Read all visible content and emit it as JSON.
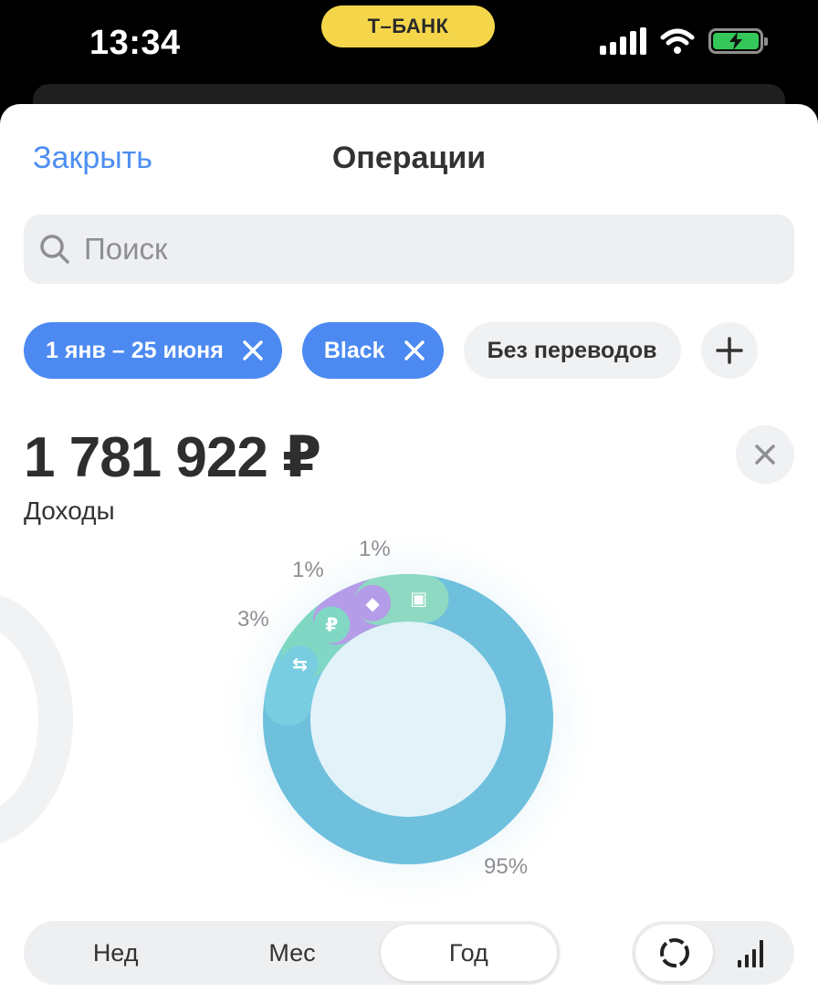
{
  "status_bar": {
    "time": "13:34",
    "bank_badge": "Т–БАНК",
    "icons": [
      "signal-icon",
      "wifi-icon",
      "battery-charging-icon"
    ]
  },
  "header": {
    "close_label": "Закрыть",
    "title": "Операции"
  },
  "search": {
    "placeholder": "Поиск"
  },
  "filters": {
    "chips": [
      {
        "label": "1 янв – 25 июня",
        "active": true,
        "removable": true
      },
      {
        "label": "Black",
        "active": true,
        "removable": true
      },
      {
        "label": "Без переводов",
        "active": false,
        "removable": false
      }
    ],
    "add_icon": "plus-icon"
  },
  "summary": {
    "amount": "1 781 922 ₽",
    "label": "Доходы"
  },
  "chart_data": {
    "type": "pie",
    "title": "",
    "slices": [
      {
        "label": "95%",
        "value": 95,
        "icon": "",
        "color": "#6ec0dd"
      },
      {
        "label": "3%",
        "value": 3,
        "icon": "transfer-icon",
        "color": "#79cde0"
      },
      {
        "label": "3%",
        "value": 3,
        "icon": "ruble-icon",
        "color": "#80d8c4"
      },
      {
        "label": "1%",
        "value": 1,
        "icon": "box-icon",
        "color": "#b59ce8"
      },
      {
        "label": "1%",
        "value": 1,
        "icon": "gift-icon",
        "color": "#8ed9c2"
      }
    ],
    "visible_labels": [
      "95%",
      "3%",
      "1%",
      "1%"
    ]
  },
  "period_selector": {
    "options": [
      "Нед",
      "Мес",
      "Год"
    ],
    "selected": "Год"
  },
  "view_toggle": {
    "options": [
      "donut-view-icon",
      "bar-view-icon"
    ],
    "selected": "donut-view-icon"
  },
  "colors": {
    "accent": "#4c8af2",
    "link": "#4d8ef2",
    "badge": "#f5d64a",
    "main_slice": "#6ec0dd"
  }
}
